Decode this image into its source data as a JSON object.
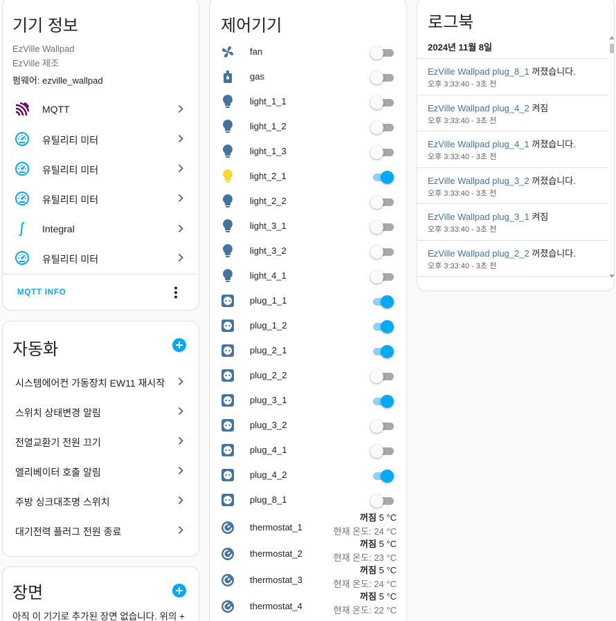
{
  "device_info": {
    "title": "기기 정보",
    "model": "EzVille Wallpad",
    "manufacturer": "EzVille 제조",
    "firmware": "펌웨어: ezville_wallpad",
    "integrations": [
      {
        "label": "MQTT",
        "icon": "mqtt-icon"
      },
      {
        "label": "유틸리티 미터",
        "icon": "gauge-icon"
      },
      {
        "label": "유틸리티 미터",
        "icon": "gauge-icon"
      },
      {
        "label": "유틸리티 미터",
        "icon": "gauge-icon"
      },
      {
        "label": "Integral",
        "icon": "integral-icon"
      },
      {
        "label": "유틸리티 미터",
        "icon": "gauge-icon"
      }
    ],
    "mqtt_info_label": "MQTT INFO"
  },
  "automations": {
    "title": "자동화",
    "items": [
      "시스템에어컨 가동장치 EW11 재시작",
      "스위치 상태변경 알림",
      "전열교환기 전원 끄기",
      "엘리베이터 호출 알림",
      "주방 싱크대조명 스위치",
      "대기전력 플러그 전원 종료"
    ]
  },
  "scenes": {
    "title": "장면",
    "empty_text": "아직 이 기기로 추가된 장면 없습니다. 위의 +"
  },
  "controls": {
    "title": "제어기기",
    "switches": [
      {
        "label": "fan",
        "icon": "fan-icon",
        "on": false
      },
      {
        "label": "gas",
        "icon": "gas-valve-icon",
        "on": false
      },
      {
        "label": "light_1_1",
        "icon": "lightbulb-icon",
        "on": false
      },
      {
        "label": "light_1_2",
        "icon": "lightbulb-icon",
        "on": false
      },
      {
        "label": "light_1_3",
        "icon": "lightbulb-icon",
        "on": false
      },
      {
        "label": "light_2_1",
        "icon": "lightbulb-icon",
        "on": true
      },
      {
        "label": "light_2_2",
        "icon": "lightbulb-icon",
        "on": false
      },
      {
        "label": "light_3_1",
        "icon": "lightbulb-icon",
        "on": false
      },
      {
        "label": "light_3_2",
        "icon": "lightbulb-icon",
        "on": false
      },
      {
        "label": "light_4_1",
        "icon": "lightbulb-icon",
        "on": false
      },
      {
        "label": "plug_1_1",
        "icon": "power-socket-icon",
        "on": true
      },
      {
        "label": "plug_1_2",
        "icon": "power-socket-icon",
        "on": true
      },
      {
        "label": "plug_2_1",
        "icon": "power-socket-icon",
        "on": true
      },
      {
        "label": "plug_2_2",
        "icon": "power-socket-icon",
        "on": false
      },
      {
        "label": "plug_3_1",
        "icon": "power-socket-icon",
        "on": true
      },
      {
        "label": "plug_3_2",
        "icon": "power-socket-icon",
        "on": false
      },
      {
        "label": "plug_4_1",
        "icon": "power-socket-icon",
        "on": false
      },
      {
        "label": "plug_4_2",
        "icon": "power-socket-icon",
        "on": true
      },
      {
        "label": "plug_8_1",
        "icon": "power-socket-icon",
        "on": false
      }
    ],
    "thermostats": [
      {
        "label": "thermostat_1",
        "state": "꺼짐",
        "target": "5 °C",
        "current": "현재 온도: 24 °C"
      },
      {
        "label": "thermostat_2",
        "state": "꺼짐",
        "target": "5 °C",
        "current": "현재 온도: 23 °C"
      },
      {
        "label": "thermostat_3",
        "state": "꺼짐",
        "target": "5 °C",
        "current": "현재 온도: 24 °C"
      },
      {
        "label": "thermostat_4",
        "state": "꺼짐",
        "target": "5 °C",
        "current": "현재 온도: 22 °C"
      }
    ]
  },
  "logbook": {
    "title": "로그북",
    "date": "2024년 11월 8일",
    "entries": [
      {
        "entity": "EzVille Wallpad plug_8_1",
        "action": " 꺼졌습니다.",
        "time": "오후 3:33:40 - 3초 전"
      },
      {
        "entity": "EzVille Wallpad plug_4_2",
        "action": " 켜짐",
        "time": "오후 3:33:40 - 3초 전"
      },
      {
        "entity": "EzVille Wallpad plug_4_1",
        "action": " 꺼졌습니다.",
        "time": "오후 3:33:40 - 3초 전"
      },
      {
        "entity": "EzVille Wallpad plug_3_2",
        "action": " 꺼졌습니다.",
        "time": "오후 3:33:40 - 3초 전"
      },
      {
        "entity": "EzVille Wallpad plug_3_1",
        "action": " 켜짐",
        "time": "오후 3:33:40 - 3초 전"
      },
      {
        "entity": "EzVille Wallpad plug_2_2",
        "action": " 꺼졌습니다.",
        "time": "오후 3:33:40 - 3초 전"
      }
    ]
  },
  "colors": {
    "accent": "#03a9f4",
    "icon_default": "#44739e",
    "icon_light_on": "#fdd835",
    "mqtt_icon": "#660066",
    "entity_link": "#44739e"
  }
}
